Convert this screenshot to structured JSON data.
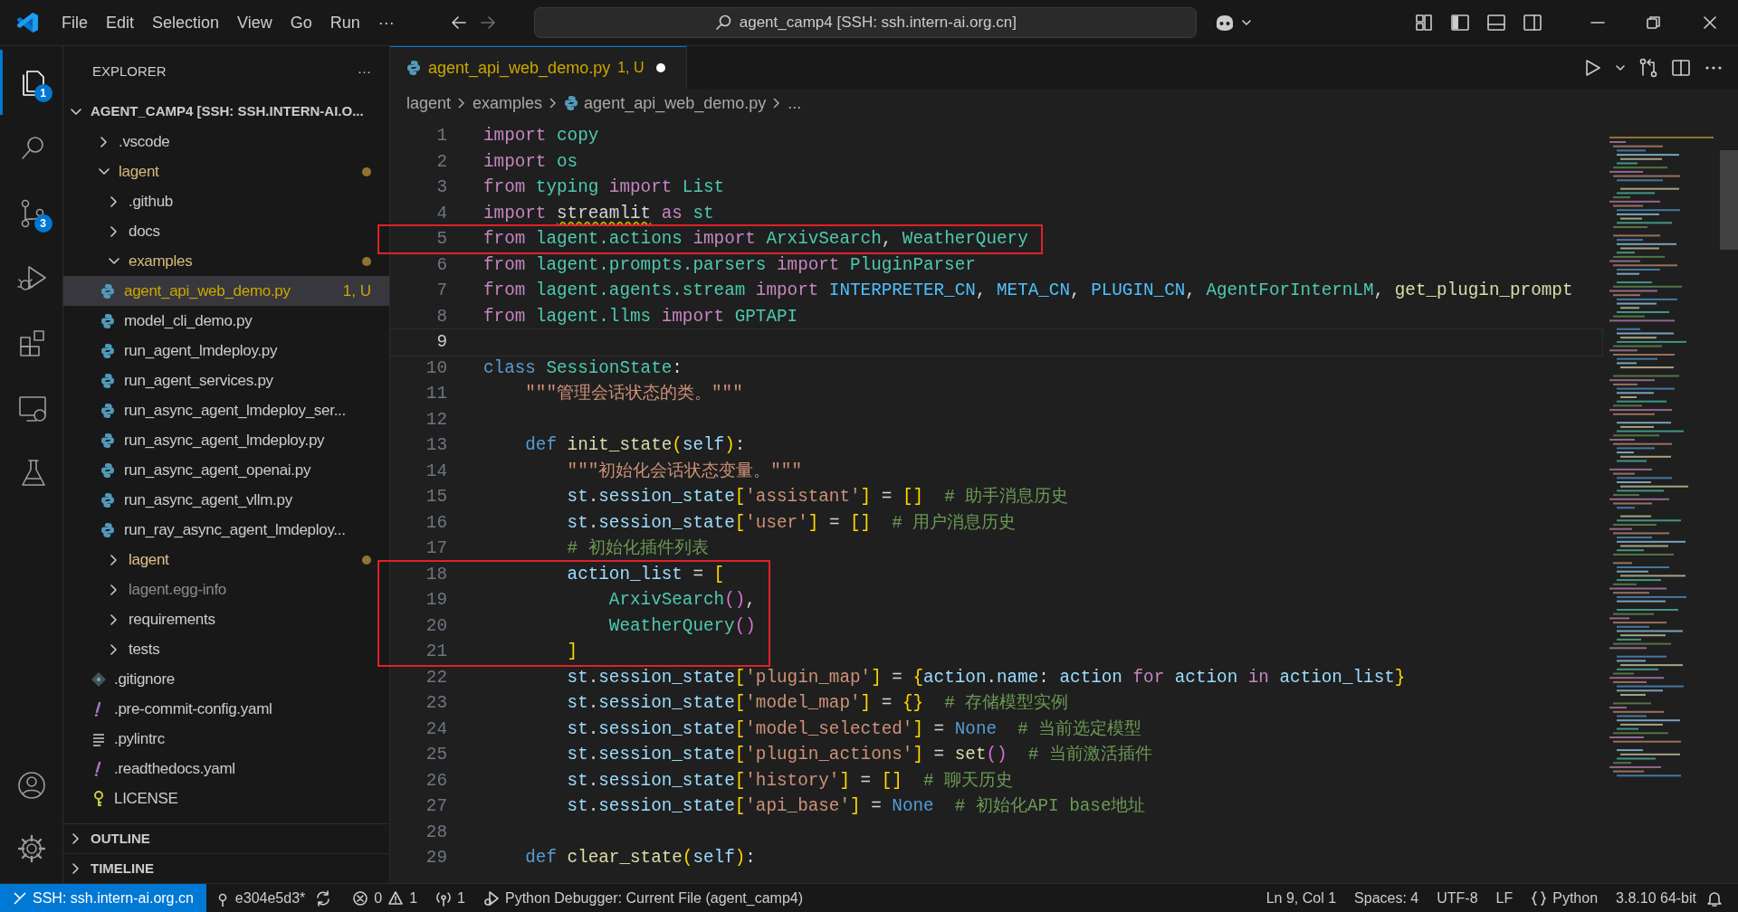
{
  "title_bar": {
    "menus": [
      "File",
      "Edit",
      "Selection",
      "View",
      "Go",
      "Run",
      "···"
    ],
    "command_center": "agent_camp4 [SSH: ssh.intern-ai.org.cn]"
  },
  "activity_bar": [
    {
      "kind": "explorer",
      "selected": true,
      "badge": "1"
    },
    {
      "kind": "search",
      "selected": false
    },
    {
      "kind": "source-control",
      "selected": false,
      "badge": "3"
    },
    {
      "kind": "run-debug",
      "selected": false
    },
    {
      "kind": "extensions",
      "selected": false
    },
    {
      "kind": "remote",
      "selected": false
    },
    {
      "kind": "testing",
      "selected": false
    }
  ],
  "sidebar": {
    "title": "EXPLORER",
    "more": "···",
    "root": {
      "label": "AGENT_CAMP4 [SSH: SSH.INTERN-AI.O...",
      "expanded": true
    },
    "tree": [
      {
        "label": ".vscode",
        "kind": "folder",
        "expanded": false,
        "selected": false,
        "color": "#cccccc",
        "dot": false
      },
      {
        "label": "lagent",
        "kind": "folder",
        "expanded": true,
        "selected": false,
        "color": "#d7ba7d",
        "dot": true,
        "children": [
          {
            "label": ".github",
            "kind": "folder",
            "expanded": false,
            "selected": false,
            "color": "#cccccc",
            "dot": false
          },
          {
            "label": "docs",
            "kind": "folder",
            "expanded": false,
            "selected": false,
            "color": "#cccccc",
            "dot": false
          },
          {
            "label": "examples",
            "kind": "folder",
            "expanded": true,
            "selected": false,
            "color": "#d7ba7d",
            "dot": true,
            "children": [
              {
                "label": "agent_api_web_demo.py",
                "kind": "python",
                "selected": true,
                "color": "#cca700",
                "dot": false,
                "decoration": "1, U"
              },
              {
                "label": "model_cli_demo.py",
                "kind": "python",
                "selected": false,
                "color": "#cccccc",
                "dot": false
              },
              {
                "label": "run_agent_lmdeploy.py",
                "kind": "python",
                "selected": false,
                "color": "#cccccc",
                "dot": false
              },
              {
                "label": "run_agent_services.py",
                "kind": "python",
                "selected": false,
                "color": "#cccccc",
                "dot": false
              },
              {
                "label": "run_async_agent_lmdeploy_ser...",
                "kind": "python",
                "selected": false,
                "color": "#cccccc",
                "dot": false
              },
              {
                "label": "run_async_agent_lmdeploy.py",
                "kind": "python",
                "selected": false,
                "color": "#cccccc",
                "dot": false
              },
              {
                "label": "run_async_agent_openai.py",
                "kind": "python",
                "selected": false,
                "color": "#cccccc",
                "dot": false
              },
              {
                "label": "run_async_agent_vllm.py",
                "kind": "python",
                "selected": false,
                "color": "#cccccc",
                "dot": false
              },
              {
                "label": "run_ray_async_agent_lmdeploy...",
                "kind": "python",
                "selected": false,
                "color": "#cccccc",
                "dot": false
              }
            ]
          },
          {
            "label": "lagent",
            "kind": "folder",
            "expanded": false,
            "selected": false,
            "color": "#e2c08d",
            "dot": true
          },
          {
            "label": "lagent.egg-info",
            "kind": "folder",
            "expanded": false,
            "selected": false,
            "color": "#8c8c8c",
            "dot": false
          },
          {
            "label": "requirements",
            "kind": "folder",
            "expanded": false,
            "selected": false,
            "color": "#cccccc",
            "dot": false
          },
          {
            "label": "tests",
            "kind": "folder",
            "expanded": false,
            "selected": false,
            "color": "#cccccc",
            "dot": false
          },
          {
            "label": ".gitignore",
            "kind": "git",
            "selected": false,
            "color": "#cccccc",
            "dot": false
          },
          {
            "label": ".pre-commit-config.yaml",
            "kind": "yaml",
            "selected": false,
            "color": "#cccccc",
            "dot": false
          },
          {
            "label": ".pylintrc",
            "kind": "text",
            "selected": false,
            "color": "#cccccc",
            "dot": false
          },
          {
            "label": ".readthedocs.yaml",
            "kind": "yaml",
            "selected": false,
            "color": "#cccccc",
            "dot": false
          },
          {
            "label": "LICENSE",
            "kind": "license",
            "selected": false,
            "color": "#cccccc",
            "dot": false
          }
        ]
      }
    ],
    "sections": [
      {
        "label": "OUTLINE",
        "expanded": false
      },
      {
        "label": "TIMELINE",
        "expanded": false
      }
    ]
  },
  "tabs": [
    {
      "label": "agent_api_web_demo.py",
      "decoration": "1, U",
      "selected": true,
      "dirty": true
    }
  ],
  "breadcrumb": [
    "lagent",
    "examples",
    "agent_api_web_demo.py",
    "..."
  ],
  "code": [
    {
      "number": "1",
      "current": false,
      "boxed": false,
      "tokens": [
        {
          "kind": "kw",
          "text": "import "
        },
        {
          "kind": "mod",
          "text": "copy"
        }
      ]
    },
    {
      "number": "2",
      "current": false,
      "boxed": false,
      "tokens": [
        {
          "kind": "kw",
          "text": "import "
        },
        {
          "kind": "mod",
          "text": "os"
        }
      ]
    },
    {
      "number": "3",
      "current": false,
      "boxed": false,
      "tokens": [
        {
          "kind": "kw",
          "text": "from "
        },
        {
          "kind": "mod",
          "text": "typing "
        },
        {
          "kind": "kw",
          "text": "import "
        },
        {
          "kind": "cls",
          "text": "List"
        }
      ]
    },
    {
      "number": "4",
      "current": false,
      "boxed": false,
      "tokens": [
        {
          "kind": "kw",
          "text": "import "
        },
        {
          "kind": "warn",
          "text": "streamlit"
        },
        {
          "kind": "kw",
          "text": " as "
        },
        {
          "kind": "mod",
          "text": "st"
        }
      ]
    },
    {
      "number": "5",
      "current": false,
      "boxed": true,
      "tokens": [
        {
          "kind": "kw",
          "text": "from "
        },
        {
          "kind": "mod",
          "text": "lagent.actions "
        },
        {
          "kind": "kw",
          "text": "import "
        },
        {
          "kind": "cls",
          "text": "ArxivSearch"
        },
        {
          "kind": "plain",
          "text": ", "
        },
        {
          "kind": "cls",
          "text": "WeatherQuery"
        }
      ]
    },
    {
      "number": "6",
      "current": false,
      "boxed": false,
      "tokens": [
        {
          "kind": "kw",
          "text": "from "
        },
        {
          "kind": "mod",
          "text": "lagent.prompts.parsers "
        },
        {
          "kind": "kw",
          "text": "import "
        },
        {
          "kind": "cls",
          "text": "PluginParser"
        }
      ]
    },
    {
      "number": "7",
      "current": false,
      "boxed": false,
      "tokens": [
        {
          "kind": "kw",
          "text": "from "
        },
        {
          "kind": "mod",
          "text": "lagent.agents.stream "
        },
        {
          "kind": "kw",
          "text": "import "
        },
        {
          "kind": "const",
          "text": "INTERPRETER_CN"
        },
        {
          "kind": "plain",
          "text": ", "
        },
        {
          "kind": "const",
          "text": "META_CN"
        },
        {
          "kind": "plain",
          "text": ", "
        },
        {
          "kind": "const",
          "text": "PLUGIN_CN"
        },
        {
          "kind": "plain",
          "text": ", "
        },
        {
          "kind": "cls",
          "text": "AgentForInternLM"
        },
        {
          "kind": "plain",
          "text": ", "
        },
        {
          "kind": "fn",
          "text": "get_plugin_prompt"
        }
      ]
    },
    {
      "number": "8",
      "current": false,
      "boxed": false,
      "tokens": [
        {
          "kind": "kw",
          "text": "from "
        },
        {
          "kind": "mod",
          "text": "lagent.llms "
        },
        {
          "kind": "kw",
          "text": "import "
        },
        {
          "kind": "cls",
          "text": "GPTAPI"
        }
      ]
    },
    {
      "number": "9",
      "current": true,
      "boxed": false
    },
    {
      "number": "10",
      "current": false,
      "boxed": false,
      "tokens": [
        {
          "kind": "kw2",
          "text": "class "
        },
        {
          "kind": "cls",
          "text": "SessionState"
        },
        {
          "kind": "plain",
          "text": ":"
        }
      ]
    },
    {
      "number": "11",
      "current": false,
      "boxed": false,
      "tokens": [
        {
          "kind": "str",
          "text": "    \"\"\"管理会话状态的类。\"\"\""
        }
      ]
    },
    {
      "number": "12",
      "current": false,
      "boxed": false
    },
    {
      "number": "13",
      "current": false,
      "boxed": false,
      "tokens": [
        {
          "kind": "kw2",
          "text": "    def "
        },
        {
          "kind": "fn",
          "text": "init_state"
        },
        {
          "kind": "b1",
          "text": "("
        },
        {
          "kind": "var",
          "text": "self"
        },
        {
          "kind": "b1",
          "text": ")"
        },
        {
          "kind": "plain",
          "text": ":"
        }
      ]
    },
    {
      "number": "14",
      "current": false,
      "boxed": false,
      "tokens": [
        {
          "kind": "str",
          "text": "        \"\"\"初始化会话状态变量。\"\"\""
        }
      ]
    },
    {
      "number": "15",
      "current": false,
      "boxed": false,
      "tokens": [
        {
          "kind": "var",
          "text": "        st"
        },
        {
          "kind": "plain",
          "text": "."
        },
        {
          "kind": "var",
          "text": "session_state"
        },
        {
          "kind": "b1",
          "text": "["
        },
        {
          "kind": "str",
          "text": "'assistant'"
        },
        {
          "kind": "b1",
          "text": "]"
        },
        {
          "kind": "plain",
          "text": " = "
        },
        {
          "kind": "b1",
          "text": "[]  "
        },
        {
          "kind": "cmt",
          "text": "# 助手消息历史"
        }
      ]
    },
    {
      "number": "16",
      "current": false,
      "boxed": false,
      "tokens": [
        {
          "kind": "var",
          "text": "        st"
        },
        {
          "kind": "plain",
          "text": "."
        },
        {
          "kind": "var",
          "text": "session_state"
        },
        {
          "kind": "b1",
          "text": "["
        },
        {
          "kind": "str",
          "text": "'user'"
        },
        {
          "kind": "b1",
          "text": "]"
        },
        {
          "kind": "plain",
          "text": " = "
        },
        {
          "kind": "b1",
          "text": "[]  "
        },
        {
          "kind": "cmt",
          "text": "# 用户消息历史"
        }
      ]
    },
    {
      "number": "17",
      "current": false,
      "boxed": false,
      "tokens": [
        {
          "kind": "cmt",
          "text": "        # 初始化插件列表"
        }
      ]
    },
    {
      "number": "18",
      "current": false,
      "boxed": true,
      "tokens": [
        {
          "kind": "var",
          "text": "        action_list"
        },
        {
          "kind": "plain",
          "text": " = "
        },
        {
          "kind": "b1",
          "text": "["
        }
      ]
    },
    {
      "number": "19",
      "current": false,
      "boxed": true,
      "tokens": [
        {
          "kind": "cls",
          "text": "            ArxivSearch"
        },
        {
          "kind": "b2",
          "text": "()"
        },
        {
          "kind": "plain",
          "text": ","
        }
      ]
    },
    {
      "number": "20",
      "current": false,
      "boxed": true,
      "tokens": [
        {
          "kind": "cls",
          "text": "            WeatherQuery"
        },
        {
          "kind": "b2",
          "text": "()"
        }
      ]
    },
    {
      "number": "21",
      "current": false,
      "boxed": true,
      "tokens": [
        {
          "kind": "b1",
          "text": "        ]"
        }
      ]
    },
    {
      "number": "22",
      "current": false,
      "boxed": false,
      "tokens": [
        {
          "kind": "var",
          "text": "        st"
        },
        {
          "kind": "plain",
          "text": "."
        },
        {
          "kind": "var",
          "text": "session_state"
        },
        {
          "kind": "b1",
          "text": "["
        },
        {
          "kind": "str",
          "text": "'plugin_map'"
        },
        {
          "kind": "b1",
          "text": "]"
        },
        {
          "kind": "plain",
          "text": " = "
        },
        {
          "kind": "b1",
          "text": "{"
        },
        {
          "kind": "var",
          "text": "action"
        },
        {
          "kind": "plain",
          "text": "."
        },
        {
          "kind": "var",
          "text": "name"
        },
        {
          "kind": "plain",
          "text": ": "
        },
        {
          "kind": "var",
          "text": "action "
        },
        {
          "kind": "kw",
          "text": "for "
        },
        {
          "kind": "var",
          "text": "action "
        },
        {
          "kind": "kw",
          "text": "in "
        },
        {
          "kind": "var",
          "text": "action_list"
        },
        {
          "kind": "b1",
          "text": "}"
        }
      ]
    },
    {
      "number": "23",
      "current": false,
      "boxed": false,
      "tokens": [
        {
          "kind": "var",
          "text": "        st"
        },
        {
          "kind": "plain",
          "text": "."
        },
        {
          "kind": "var",
          "text": "session_state"
        },
        {
          "kind": "b1",
          "text": "["
        },
        {
          "kind": "str",
          "text": "'model_map'"
        },
        {
          "kind": "b1",
          "text": "]"
        },
        {
          "kind": "plain",
          "text": " = "
        },
        {
          "kind": "b1",
          "text": "{}  "
        },
        {
          "kind": "cmt",
          "text": "# 存储模型实例"
        }
      ]
    },
    {
      "number": "24",
      "current": false,
      "boxed": false,
      "tokens": [
        {
          "kind": "var",
          "text": "        st"
        },
        {
          "kind": "plain",
          "text": "."
        },
        {
          "kind": "var",
          "text": "session_state"
        },
        {
          "kind": "b1",
          "text": "["
        },
        {
          "kind": "str",
          "text": "'model_selected'"
        },
        {
          "kind": "b1",
          "text": "]"
        },
        {
          "kind": "plain",
          "text": " = "
        },
        {
          "kind": "kw2",
          "text": "None  "
        },
        {
          "kind": "cmt",
          "text": "# 当前选定模型"
        }
      ]
    },
    {
      "number": "25",
      "current": false,
      "boxed": false,
      "tokens": [
        {
          "kind": "var",
          "text": "        st"
        },
        {
          "kind": "plain",
          "text": "."
        },
        {
          "kind": "var",
          "text": "session_state"
        },
        {
          "kind": "b1",
          "text": "["
        },
        {
          "kind": "str",
          "text": "'plugin_actions'"
        },
        {
          "kind": "b1",
          "text": "]"
        },
        {
          "kind": "plain",
          "text": " = "
        },
        {
          "kind": "fn",
          "text": "set"
        },
        {
          "kind": "b2",
          "text": "()  "
        },
        {
          "kind": "cmt",
          "text": "# 当前激活插件"
        }
      ]
    },
    {
      "number": "26",
      "current": false,
      "boxed": false,
      "tokens": [
        {
          "kind": "var",
          "text": "        st"
        },
        {
          "kind": "plain",
          "text": "."
        },
        {
          "kind": "var",
          "text": "session_state"
        },
        {
          "kind": "b1",
          "text": "["
        },
        {
          "kind": "str",
          "text": "'history'"
        },
        {
          "kind": "b1",
          "text": "]"
        },
        {
          "kind": "plain",
          "text": " = "
        },
        {
          "kind": "b1",
          "text": "[]  "
        },
        {
          "kind": "cmt",
          "text": "# 聊天历史"
        }
      ]
    },
    {
      "number": "27",
      "current": false,
      "boxed": false,
      "tokens": [
        {
          "kind": "var",
          "text": "        st"
        },
        {
          "kind": "plain",
          "text": "."
        },
        {
          "kind": "var",
          "text": "session_state"
        },
        {
          "kind": "b1",
          "text": "["
        },
        {
          "kind": "str",
          "text": "'api_base'"
        },
        {
          "kind": "b1",
          "text": "]"
        },
        {
          "kind": "plain",
          "text": " = "
        },
        {
          "kind": "kw2",
          "text": "None  "
        },
        {
          "kind": "cmt",
          "text": "# 初始化API base地址"
        }
      ]
    },
    {
      "number": "28",
      "current": false,
      "boxed": false
    },
    {
      "number": "29",
      "current": false,
      "boxed": false,
      "tokens": [
        {
          "kind": "kw2",
          "text": "    def "
        },
        {
          "kind": "fn",
          "text": "clear_state"
        },
        {
          "kind": "b1",
          "text": "("
        },
        {
          "kind": "var",
          "text": "self"
        },
        {
          "kind": "b1",
          "text": ")"
        },
        {
          "kind": "plain",
          "text": ":"
        }
      ]
    }
  ],
  "status_bar": {
    "remote": "SSH: ssh.intern-ai.org.cn",
    "branch": "e304e5d3*",
    "errors": "0",
    "warnings": "1",
    "ports": "1",
    "debug": "Python Debugger: Current File (agent_camp4)",
    "right": [
      {
        "kind": "text",
        "text": "Ln 9, Col 1"
      },
      {
        "kind": "text",
        "text": "Spaces: 4"
      },
      {
        "kind": "text",
        "text": "UTF-8"
      },
      {
        "kind": "text",
        "text": "LF"
      },
      {
        "kind": "language",
        "text": "Python"
      },
      {
        "kind": "text",
        "text": "3.8.10 64-bit"
      },
      {
        "kind": "bell"
      }
    ]
  }
}
